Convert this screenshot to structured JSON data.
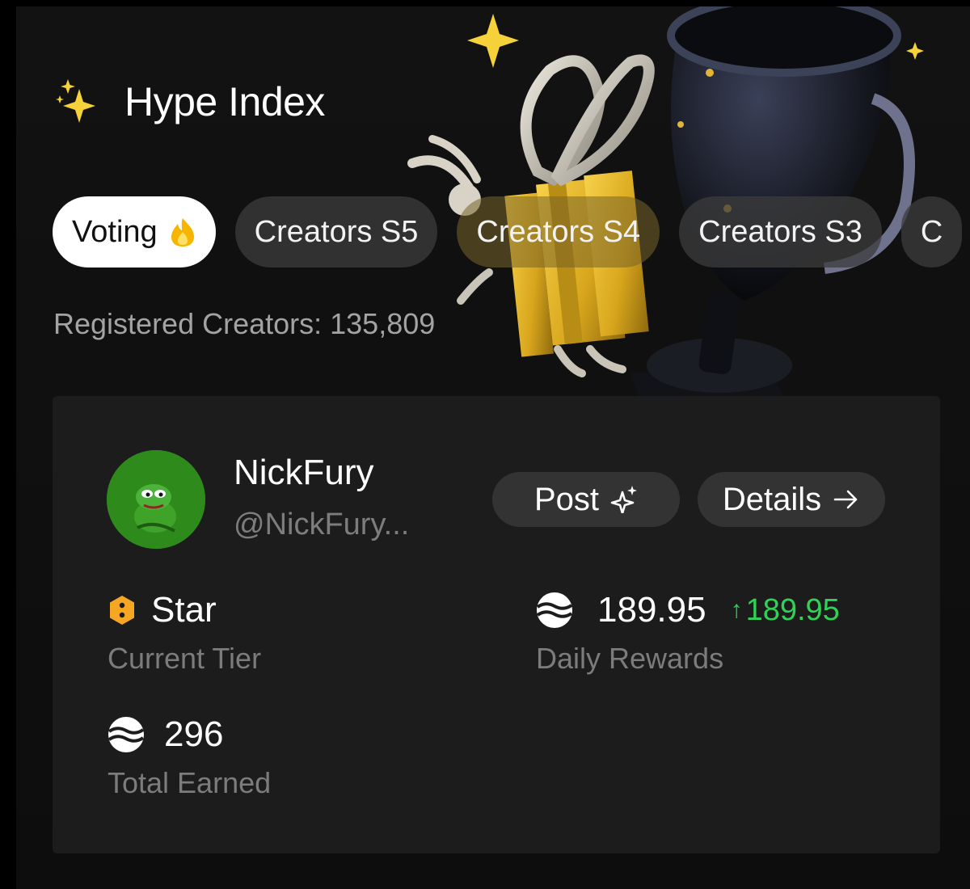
{
  "header": {
    "title": "Hype Index",
    "icon": "sparkles-icon",
    "accent": "#f6d23a"
  },
  "tabs": [
    {
      "label": "Voting",
      "active": true,
      "icon": "flame-icon"
    },
    {
      "label": "Creators S5",
      "active": false
    },
    {
      "label": "Creators S4",
      "active": false
    },
    {
      "label": "Creators S3",
      "active": false
    },
    {
      "label": "C",
      "active": false
    }
  ],
  "registered_text": "Registered Creators: 135,809",
  "profile": {
    "name": "NickFury",
    "handle": "@NickFury...",
    "post_label": "Post",
    "details_label": "Details"
  },
  "stats": {
    "tier": {
      "value": "Star",
      "label": "Current Tier",
      "icon": "hexagon-tier-icon",
      "color": "#f5a623"
    },
    "daily": {
      "value": "189.95",
      "change": "189.95",
      "label": "Daily Rewards",
      "icon": "coin-wave-icon",
      "change_color": "#31d158"
    },
    "total": {
      "value": "296",
      "label": "Total Earned",
      "icon": "coin-wave-icon"
    }
  }
}
